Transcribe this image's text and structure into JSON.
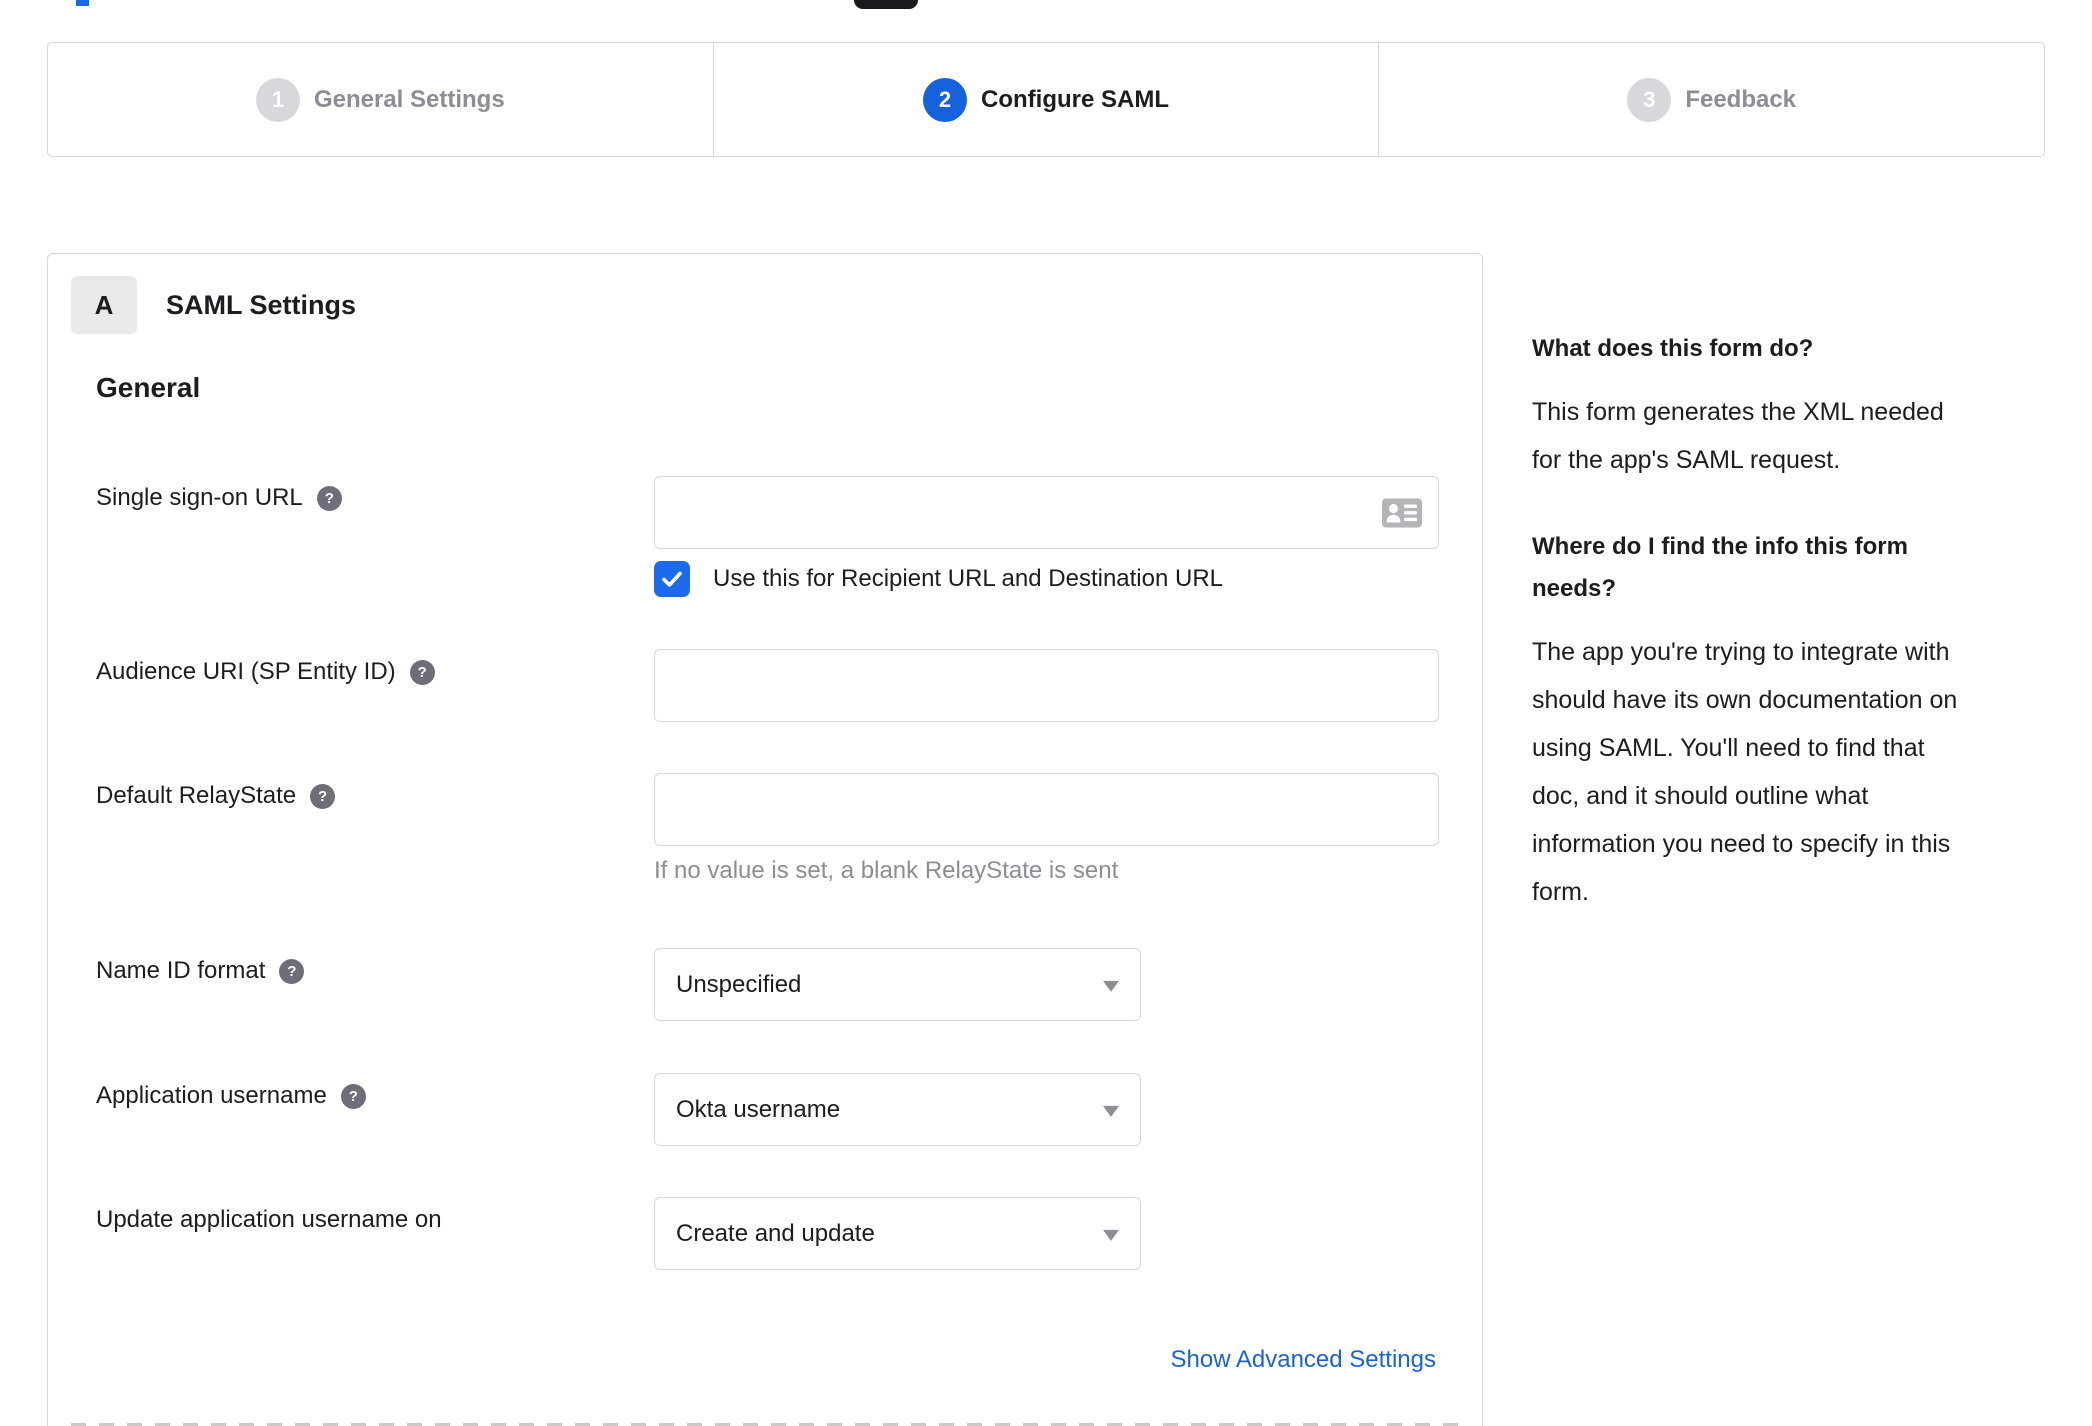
{
  "colors": {
    "accent_blue": "#1662dd",
    "checkbox_blue": "#1b6aec",
    "link_blue": "#1a62dd",
    "border_gray": "#d7d7dc",
    "inactive_gray": "#8d8d95",
    "text_dark": "#1d1d21",
    "badge_bg": "#e9e9eb",
    "help_icon_gray": "#6e6e78",
    "card_icon_gray": "#b3b3b8"
  },
  "icons": {
    "help_glyph": "?"
  },
  "stepper": {
    "steps": [
      {
        "number": "1",
        "label": "General Settings",
        "state": "inactive"
      },
      {
        "number": "2",
        "label": "Configure SAML",
        "state": "active"
      },
      {
        "number": "3",
        "label": "Feedback",
        "state": "inactive"
      }
    ]
  },
  "panel": {
    "badge": "A",
    "title": "SAML Settings",
    "section": "General",
    "fields": [
      {
        "label": "Single sign-on URL",
        "has_help": true,
        "type": "text",
        "value": "",
        "checkbox": {
          "checked": true,
          "label": "Use this for Recipient URL and Destination URL"
        }
      },
      {
        "label": "Audience URI (SP Entity ID)",
        "has_help": true,
        "type": "text",
        "value": ""
      },
      {
        "label": "Default RelayState",
        "has_help": true,
        "type": "text",
        "value": "",
        "hint": "If no value is set, a blank RelayState is sent"
      },
      {
        "label": "Name ID format",
        "has_help": true,
        "type": "select",
        "value": "Unspecified"
      },
      {
        "label": "Application username",
        "has_help": true,
        "type": "select",
        "value": "Okta username"
      },
      {
        "label": "Update application username on",
        "has_help": false,
        "type": "select",
        "value": "Create and update"
      }
    ],
    "advanced_link": "Show Advanced Settings"
  },
  "sidebar": {
    "q1": {
      "heading": "What does this form do?",
      "body": "This form generates the XML needed\nfor the app's SAML request."
    },
    "q2": {
      "heading": "Where do I find the info this form\nneeds?",
      "body": "The app you're trying to integrate with\nshould have its own documentation on\nusing SAML. You'll need to find that\ndoc, and it should outline what\ninformation you need to specify in this\nform."
    }
  }
}
